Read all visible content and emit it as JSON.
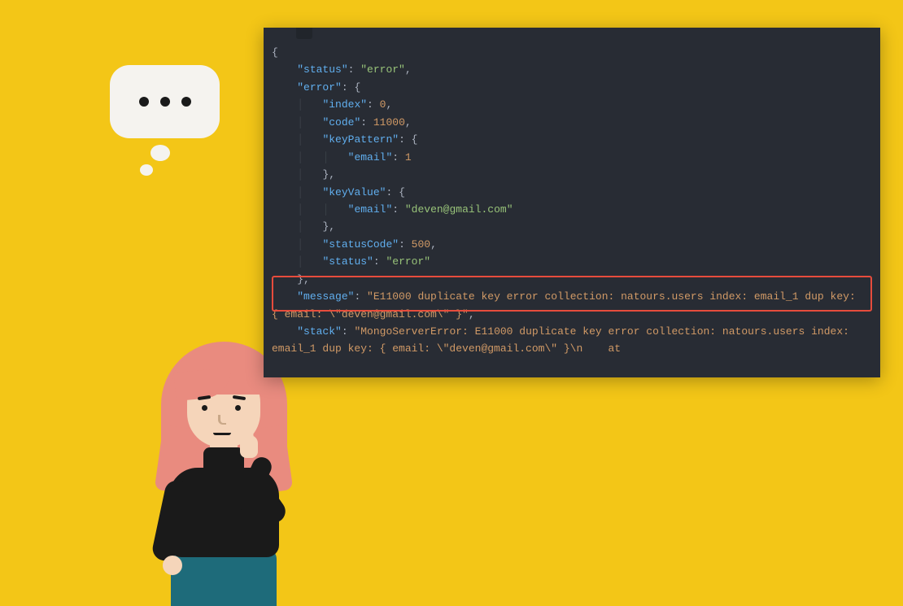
{
  "code": {
    "status_key": "\"status\"",
    "status_val": "\"error\"",
    "error_key": "\"error\"",
    "index_key": "\"index\"",
    "index_val": "0",
    "code_key": "\"code\"",
    "code_val": "11000",
    "keyPattern_key": "\"keyPattern\"",
    "email_key": "\"email\"",
    "email_pattern_val": "1",
    "keyValue_key": "\"keyValue\"",
    "email_value": "\"deven@gmail.com\"",
    "statusCode_key": "\"statusCode\"",
    "statusCode_val": "500",
    "inner_status_key": "\"status\"",
    "inner_status_val": "\"error\"",
    "message_key": "\"message\"",
    "message_val": "\"E11000 duplicate key error collection: natours.users index: email_1 dup key: { email: \\\"deven@gmail.com\\\" }\"",
    "stack_key": "\"stack\"",
    "stack_val": "\"MongoServerError: E11000 duplicate key error collection: natours.users index: email_1 dup key: { email: \\\"deven@gmail.com\\\" }\\n    at"
  }
}
